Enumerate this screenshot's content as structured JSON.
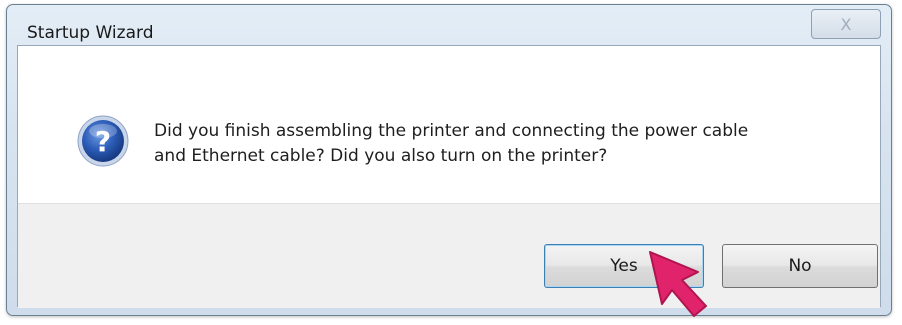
{
  "window": {
    "title": "Startup Wizard",
    "close_glyph": "X"
  },
  "message": {
    "icon": "question-icon",
    "icon_glyph": "?",
    "text_line1": "Did you finish assembling the printer and connecting the power cable",
    "text_line2": "and Ethernet cable? Did you also turn on the printer?"
  },
  "buttons": {
    "yes_label": "Yes",
    "no_label": "No"
  },
  "pointer": {
    "icon": "arrow-pointer-icon",
    "color": "#e0236a"
  },
  "colors": {
    "icon_blue": "#1f4fa8",
    "focus_border": "#3c7fb1"
  }
}
